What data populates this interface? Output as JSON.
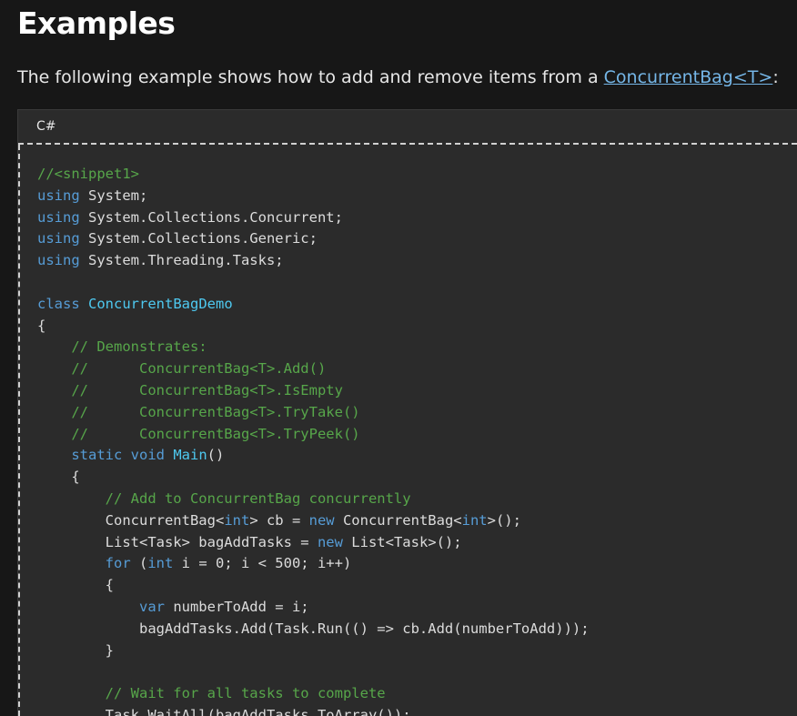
{
  "heading": "Examples",
  "intro": {
    "prefix": "The following example shows how to add and remove items from a ",
    "link_text": "ConcurrentBag<T>",
    "suffix": ":"
  },
  "code_block": {
    "language": "C#",
    "lines": [
      [
        {
          "t": "//<snippet1>",
          "c": "comment"
        }
      ],
      [
        {
          "t": "using",
          "c": "keyword"
        },
        {
          "t": " System;",
          "c": "plain"
        }
      ],
      [
        {
          "t": "using",
          "c": "keyword"
        },
        {
          "t": " System.Collections.Concurrent;",
          "c": "plain"
        }
      ],
      [
        {
          "t": "using",
          "c": "keyword"
        },
        {
          "t": " System.Collections.Generic;",
          "c": "plain"
        }
      ],
      [
        {
          "t": "using",
          "c": "keyword"
        },
        {
          "t": " System.Threading.Tasks;",
          "c": "plain"
        }
      ],
      [],
      [
        {
          "t": "class",
          "c": "keyword"
        },
        {
          "t": " ",
          "c": "plain"
        },
        {
          "t": "ConcurrentBagDemo",
          "c": "type"
        }
      ],
      [
        {
          "t": "{",
          "c": "plain"
        }
      ],
      [
        {
          "t": "    ",
          "c": "plain"
        },
        {
          "t": "// Demonstrates:",
          "c": "comment"
        }
      ],
      [
        {
          "t": "    ",
          "c": "plain"
        },
        {
          "t": "//      ConcurrentBag<T>.Add()",
          "c": "comment"
        }
      ],
      [
        {
          "t": "    ",
          "c": "plain"
        },
        {
          "t": "//      ConcurrentBag<T>.IsEmpty",
          "c": "comment"
        }
      ],
      [
        {
          "t": "    ",
          "c": "plain"
        },
        {
          "t": "//      ConcurrentBag<T>.TryTake()",
          "c": "comment"
        }
      ],
      [
        {
          "t": "    ",
          "c": "plain"
        },
        {
          "t": "//      ConcurrentBag<T>.TryPeek()",
          "c": "comment"
        }
      ],
      [
        {
          "t": "    ",
          "c": "plain"
        },
        {
          "t": "static",
          "c": "keyword"
        },
        {
          "t": " ",
          "c": "plain"
        },
        {
          "t": "void",
          "c": "keyword"
        },
        {
          "t": " ",
          "c": "plain"
        },
        {
          "t": "Main",
          "c": "type"
        },
        {
          "t": "()",
          "c": "plain"
        }
      ],
      [
        {
          "t": "    {",
          "c": "plain"
        }
      ],
      [
        {
          "t": "        ",
          "c": "plain"
        },
        {
          "t": "// Add to ConcurrentBag concurrently",
          "c": "comment"
        }
      ],
      [
        {
          "t": "        ConcurrentBag<",
          "c": "plain"
        },
        {
          "t": "int",
          "c": "keyword"
        },
        {
          "t": "> cb = ",
          "c": "plain"
        },
        {
          "t": "new",
          "c": "keyword"
        },
        {
          "t": " ConcurrentBag<",
          "c": "plain"
        },
        {
          "t": "int",
          "c": "keyword"
        },
        {
          "t": ">();",
          "c": "plain"
        }
      ],
      [
        {
          "t": "        List<Task> bagAddTasks = ",
          "c": "plain"
        },
        {
          "t": "new",
          "c": "keyword"
        },
        {
          "t": " List<Task>();",
          "c": "plain"
        }
      ],
      [
        {
          "t": "        ",
          "c": "plain"
        },
        {
          "t": "for",
          "c": "keyword"
        },
        {
          "t": " (",
          "c": "plain"
        },
        {
          "t": "int",
          "c": "keyword"
        },
        {
          "t": " i = 0; i < 500; i++)",
          "c": "plain"
        }
      ],
      [
        {
          "t": "        {",
          "c": "plain"
        }
      ],
      [
        {
          "t": "            ",
          "c": "plain"
        },
        {
          "t": "var",
          "c": "keyword"
        },
        {
          "t": " numberToAdd = i;",
          "c": "plain"
        }
      ],
      [
        {
          "t": "            bagAddTasks.Add(Task.Run(() => cb.Add(numberToAdd)));",
          "c": "plain"
        }
      ],
      [
        {
          "t": "        }",
          "c": "plain"
        }
      ],
      [],
      [
        {
          "t": "        ",
          "c": "plain"
        },
        {
          "t": "// Wait for all tasks to complete",
          "c": "comment"
        }
      ],
      [
        {
          "t": "        Task.WaitAll(bagAddTasks.ToArray());",
          "c": "plain"
        }
      ]
    ]
  }
}
